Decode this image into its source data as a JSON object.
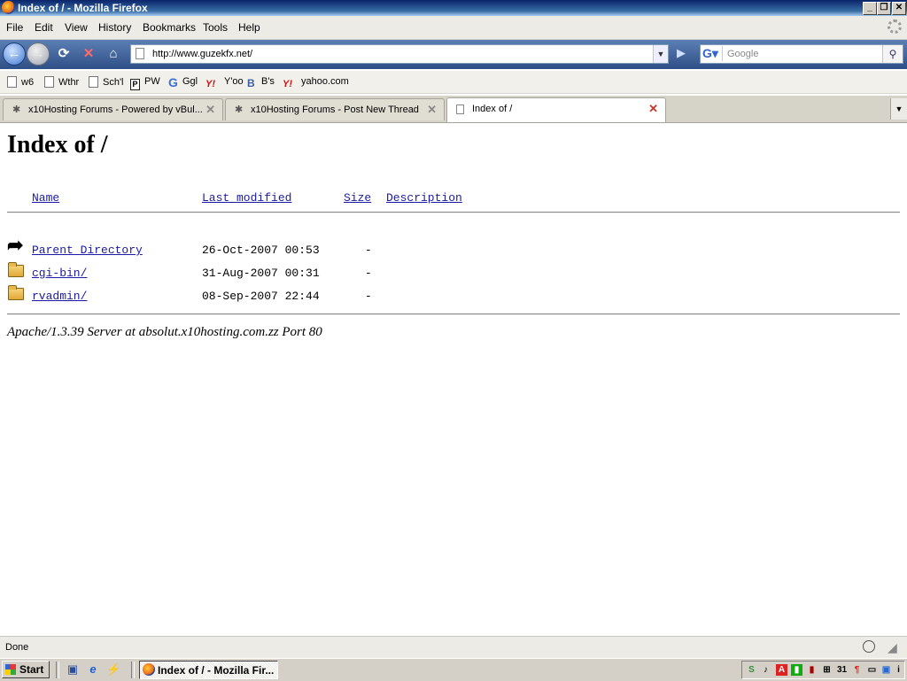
{
  "window": {
    "title": "Index of / - Mozilla Firefox"
  },
  "menu": [
    "File",
    "Edit",
    "View",
    "History",
    "Bookmarks",
    "Tools",
    "Help"
  ],
  "nav": {
    "url": "http://www.guzekfx.net/",
    "search_placeholder": "Google"
  },
  "bookmarks": [
    {
      "label": "w6",
      "icon": "page-icon"
    },
    {
      "label": "Wthr",
      "icon": "page-icon"
    },
    {
      "label": "Sch'l",
      "icon": "page-icon"
    },
    {
      "label": "PW",
      "icon": "p-icon"
    },
    {
      "label": "Ggl",
      "icon": "google-icon"
    },
    {
      "label": "Y'oo",
      "icon": "yahoo-icon"
    },
    {
      "label": "B's",
      "icon": "bb-icon"
    },
    {
      "label": "yahoo.com",
      "icon": "yahoo-icon"
    }
  ],
  "tabs": [
    {
      "label": "x10Hosting Forums - Powered by vBul...",
      "active": false
    },
    {
      "label": "x10Hosting Forums - Post New Thread",
      "active": false
    },
    {
      "label": "Index of /",
      "active": true
    }
  ],
  "page": {
    "heading": "Index of /",
    "columns": {
      "name": "Name",
      "modified": "Last modified",
      "size": "Size",
      "description": "Description"
    },
    "rows": [
      {
        "name": "Parent Directory",
        "modified": "26-Oct-2007 00:53",
        "size": "-",
        "icon": "back-arrow-icon"
      },
      {
        "name": "cgi-bin/",
        "modified": "31-Aug-2007 00:31",
        "size": "-",
        "icon": "folder-icon"
      },
      {
        "name": "rvadmin/",
        "modified": "08-Sep-2007 22:44",
        "size": "-",
        "icon": "folder-icon"
      }
    ],
    "address": "Apache/1.3.39 Server at absolut.x10hosting.com.zz Port 80"
  },
  "status": {
    "text": "Done"
  },
  "taskbar": {
    "start_label": "Start",
    "active_window": "Index of / - Mozilla Fir..."
  }
}
